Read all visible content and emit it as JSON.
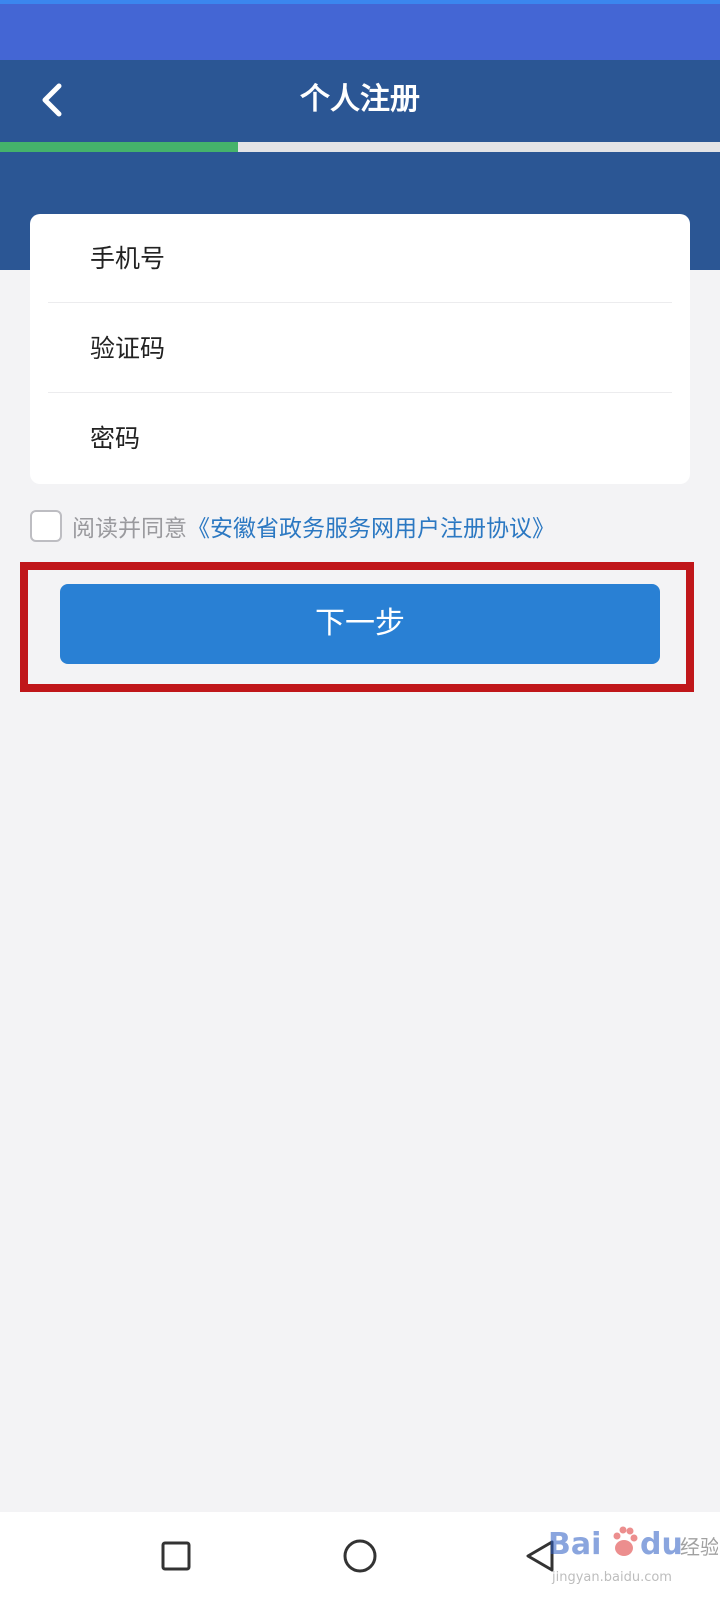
{
  "header": {
    "title": "个人注册",
    "progress_fraction": 0.33
  },
  "form": {
    "phone_label": "手机号",
    "code_label": "验证码",
    "password_label": "密码"
  },
  "agreement": {
    "prefix": "阅读并同意",
    "link": "《安徽省政务服务网用户注册协议》",
    "checked": false
  },
  "actions": {
    "next_label": "下一步"
  },
  "watermark": {
    "url": "jingyan.baidu.com"
  },
  "colors": {
    "header": "#2b5694",
    "status_bar": "#4466d4",
    "progress": "#45b36b",
    "primary_button": "#2980d4",
    "link": "#2b78c2",
    "highlight": "#c0161a"
  },
  "icons": {
    "back": "chevron-left-icon",
    "nav_recents": "square-icon",
    "nav_home": "circle-icon",
    "nav_back": "triangle-back-icon"
  }
}
